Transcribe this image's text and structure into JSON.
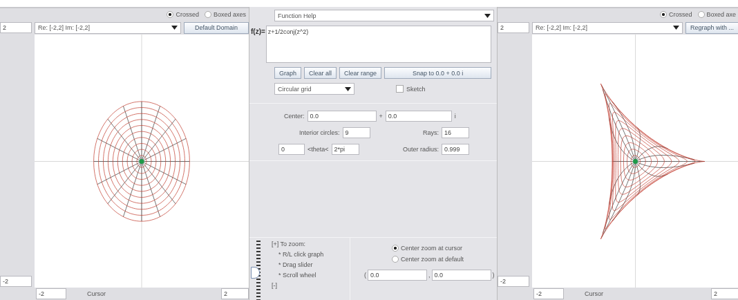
{
  "left_graph": {
    "kind": "domain",
    "axes_options": [
      {
        "label": "Crossed",
        "selected": true
      },
      {
        "label": "Boxed axes",
        "selected": false
      }
    ],
    "y_max": "2",
    "domain": "Re: [-2,2]   Im: [-2,2]",
    "button": "Default Domain",
    "y_min": "-2",
    "x_min": "-2",
    "cursor_label": "Cursor",
    "x_max": "2"
  },
  "function_panel": {
    "help": "Function Help",
    "f_label": "f(z)=",
    "formula": "z+1/2conj(z^2)",
    "buttons": [
      "Graph",
      "Clear all",
      "Clear range",
      "Snap to 0.0 + 0.0 i"
    ],
    "grid_type": "Circular grid",
    "sketch": {
      "label": "Sketch",
      "checked": false
    },
    "center_label": "Center:",
    "center_re": "0.0",
    "plus": "+",
    "center_im": "0.0",
    "i_label": "i",
    "circles_label": "Interior circles:",
    "circles": "9",
    "rays_label": "Rays:",
    "rays": "16",
    "theta_min": "0",
    "theta_label": "<theta<",
    "theta_max": "2*pi",
    "radius_label": "Outer radius:",
    "radius": "0.999",
    "zoom_slider": {
      "plus": "[+]",
      "minus": "[-]"
    },
    "zoom_help": [
      "To zoom:",
      "* R/L click graph",
      "* Drag slider",
      "* Scroll wheel"
    ],
    "zoom_options": [
      {
        "label": "Center zoom at cursor",
        "selected": true
      },
      {
        "label": "Center zoom at default",
        "selected": false
      }
    ],
    "zoom_center": {
      "open": "(",
      "re": "0.0",
      "comma": ",",
      "im": "0.0",
      "close": ")"
    }
  },
  "right_graph": {
    "kind": "image",
    "axes_options": [
      {
        "label": "Crossed",
        "selected": true
      },
      {
        "label": "Boxed axe",
        "selected": false
      }
    ],
    "y_max": "2",
    "domain": "Re: [-2,2]   Im: [-2,2]",
    "button": "Regraph with ...",
    "y_min": "-2",
    "x_min": "-2",
    "cursor_label": "Cursor",
    "x_max": "2"
  }
}
